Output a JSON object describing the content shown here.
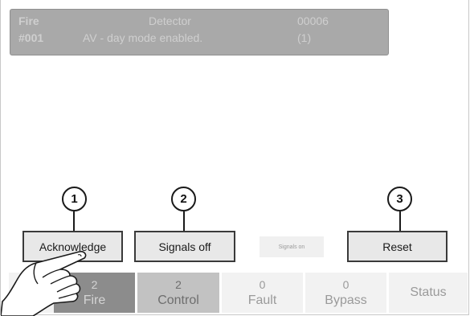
{
  "event": {
    "type": "Fire",
    "source": "Detector",
    "code": "00006",
    "number": "#001",
    "text": "AV - day mode enabled.",
    "count": "(1)"
  },
  "callouts": {
    "ack": "1",
    "signals_off": "2",
    "reset": "3"
  },
  "buttons": {
    "acknowledge": "Acknowledge",
    "signals_off": "Signals off",
    "signals_on": "Signals on",
    "reset": "Reset"
  },
  "tabs": {
    "fire": {
      "count": "2",
      "label": "Fire"
    },
    "control": {
      "count": "2",
      "label": "Control"
    },
    "fault": {
      "count": "0",
      "label": "Fault"
    },
    "bypass": {
      "count": "0",
      "label": "Bypass"
    },
    "status": {
      "label": "Status"
    }
  },
  "icons": {
    "pointer": "hand-pointer-icon"
  },
  "colors": {
    "active_tab": "#8c8c8c",
    "event_panel": "#a9a9a9",
    "button_border": "#3a3a3a"
  }
}
